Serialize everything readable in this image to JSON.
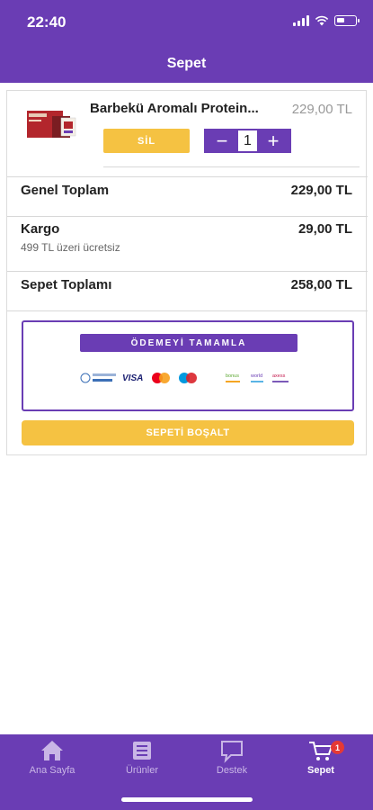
{
  "status_bar": {
    "time": "22:40"
  },
  "header": {
    "title": "Sepet"
  },
  "cart_item": {
    "name": "Barbekü Aromalı Protein...",
    "price": "229,00 TL",
    "delete_label": "SİL",
    "minus": "−",
    "quantity": "1",
    "plus": "+"
  },
  "summary": {
    "general_total_label": "Genel Toplam",
    "general_total_value": "229,00 TL",
    "shipping_label": "Kargo",
    "shipping_value": "29,00 TL",
    "shipping_note": "499 TL üzeri ücretsiz",
    "cart_total_label": "Sepet Toplamı",
    "cart_total_value": "258,00 TL"
  },
  "payment": {
    "complete_label": "ÖDEMEYİ TAMAMLA",
    "logos": [
      "VISA",
      "MasterCard",
      "Maestro",
      "bonus",
      "world",
      "axess"
    ]
  },
  "clear_cart_label": "SEPETİ BOŞALT",
  "tabbar": {
    "items": [
      {
        "label": "Ana Sayfa",
        "icon": "home-icon"
      },
      {
        "label": "Ürünler",
        "icon": "list-icon"
      },
      {
        "label": "Destek",
        "icon": "chat-icon"
      },
      {
        "label": "Sepet",
        "icon": "cart-icon",
        "badge": "1",
        "active": true
      }
    ]
  },
  "colors": {
    "primary": "#6a3db4",
    "accent": "#f5c242",
    "badge": "#e53935"
  }
}
